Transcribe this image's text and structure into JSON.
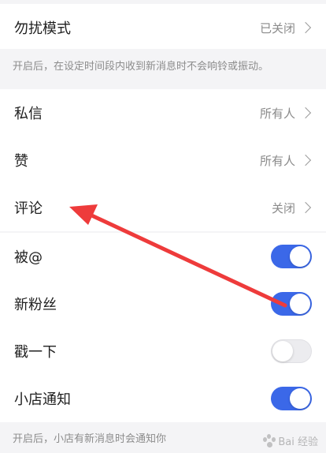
{
  "dnd": {
    "label": "勿扰模式",
    "value": "已关闭",
    "note": "开启后，在设定时间段内收到新消息时不会响铃或振动。"
  },
  "settings": [
    {
      "label": "私信",
      "value": "所有人"
    },
    {
      "label": "赞",
      "value": "所有人"
    },
    {
      "label": "评论",
      "value": "关闭"
    }
  ],
  "toggles": [
    {
      "label": "被@",
      "on": true
    },
    {
      "label": "新粉丝",
      "on": true
    },
    {
      "label": "戳一下",
      "on": false
    },
    {
      "label": "小店通知",
      "on": true
    }
  ],
  "shop_note": "开启后，小店有新消息时会通知你",
  "colors": {
    "switch_on": "#3b68e8",
    "switch_off": "#ececef",
    "arrow": "#ee3b3b"
  },
  "watermark": "Bai 经验"
}
